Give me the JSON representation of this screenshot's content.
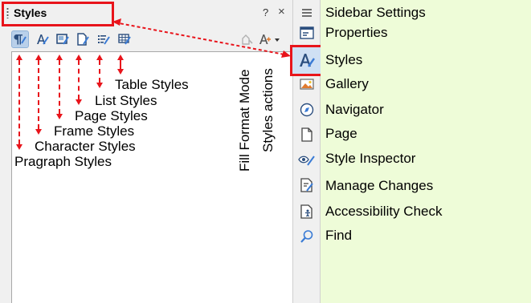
{
  "deck": {
    "title": "Styles",
    "help_glyph": "?",
    "close_glyph": "×",
    "toolbar": [
      {
        "name": "paragraph-styles",
        "icon": "paragraph-styles-icon"
      },
      {
        "name": "character-styles",
        "icon": "character-styles-icon"
      },
      {
        "name": "frame-styles",
        "icon": "frame-styles-icon"
      },
      {
        "name": "page-styles",
        "icon": "page-styles-icon"
      },
      {
        "name": "list-styles",
        "icon": "list-styles-icon"
      },
      {
        "name": "table-styles",
        "icon": "table-styles-icon"
      },
      {
        "name": "fill-format-mode",
        "icon": "fill-format-icon"
      },
      {
        "name": "styles-actions",
        "icon": "styles-actions-icon"
      }
    ]
  },
  "annotations": {
    "table_styles": "Table Styles",
    "list_styles": "List Styles",
    "page_styles": "Page Styles",
    "frame_styles": "Frame Styles",
    "character_styles": "Character Styles",
    "paragraph_styles": "Pragraph Styles",
    "fill_format_mode": "Fill Format Mode",
    "styles_actions": "Styles actions"
  },
  "tabs": [
    {
      "label": "Sidebar Settings",
      "icon": "menu-icon"
    },
    {
      "label": "Properties",
      "icon": "properties-icon"
    },
    {
      "label": "Styles",
      "icon": "styles-icon"
    },
    {
      "label": "Gallery",
      "icon": "gallery-icon"
    },
    {
      "label": "Navigator",
      "icon": "navigator-icon"
    },
    {
      "label": "Page",
      "icon": "page-icon"
    },
    {
      "label": "Style Inspector",
      "icon": "style-inspector-icon"
    },
    {
      "label": "Manage Changes",
      "icon": "manage-changes-icon"
    },
    {
      "label": "Accessibility Check",
      "icon": "accessibility-check-icon"
    },
    {
      "label": "Find",
      "icon": "find-icon"
    }
  ],
  "colors": {
    "annotation_red": "#e8141b",
    "labels_panel_bg": "#eefcd8",
    "selected_tab_bg": "#cfe0f4"
  }
}
